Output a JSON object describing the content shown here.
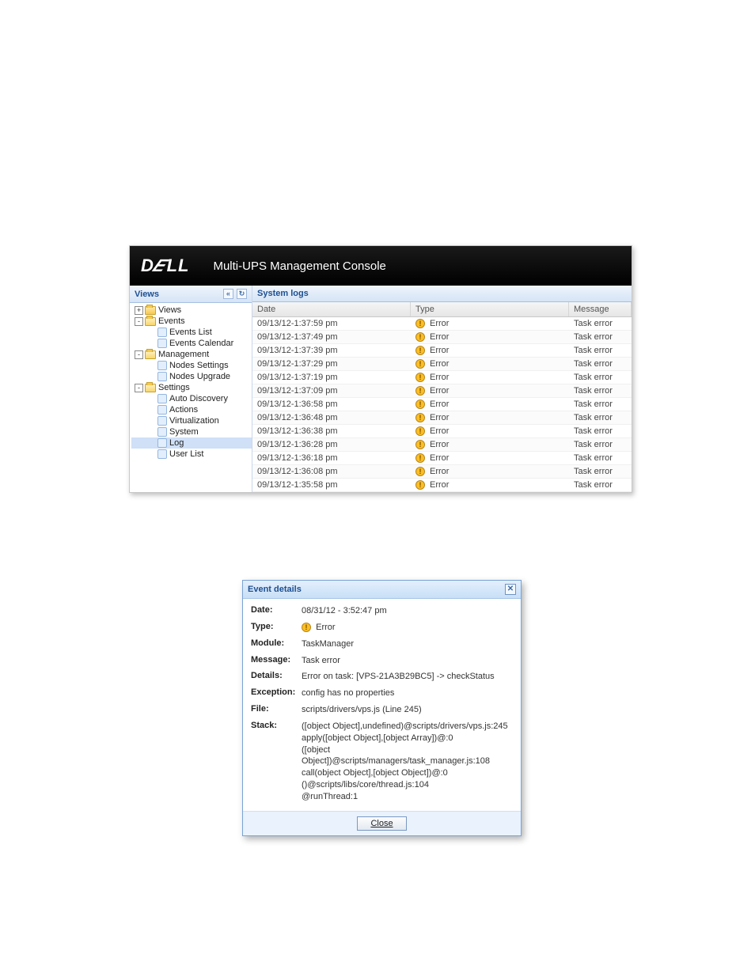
{
  "header": {
    "logo": "DELL",
    "title": "Multi-UPS Management Console"
  },
  "sidebar": {
    "title": "Views",
    "nodes": [
      {
        "label": "Views",
        "level": 1,
        "icon": "folder-closed",
        "toggle": "+",
        "interact": true,
        "name": "tree-views"
      },
      {
        "label": "Events",
        "level": 1,
        "icon": "folder-open",
        "toggle": "-",
        "interact": true,
        "name": "tree-events"
      },
      {
        "label": "Events List",
        "level": 2,
        "icon": "generic",
        "toggle": "",
        "interact": true,
        "name": "tree-events-list"
      },
      {
        "label": "Events Calendar",
        "level": 2,
        "icon": "generic",
        "toggle": "",
        "interact": true,
        "name": "tree-events-calendar"
      },
      {
        "label": "Management",
        "level": 1,
        "icon": "folder-open",
        "toggle": "-",
        "interact": true,
        "name": "tree-management"
      },
      {
        "label": "Nodes Settings",
        "level": 2,
        "icon": "generic",
        "toggle": "",
        "interact": true,
        "name": "tree-nodes-settings"
      },
      {
        "label": "Nodes Upgrade",
        "level": 2,
        "icon": "generic",
        "toggle": "",
        "interact": true,
        "name": "tree-nodes-upgrade"
      },
      {
        "label": "Settings",
        "level": 1,
        "icon": "folder-open",
        "toggle": "-",
        "interact": true,
        "name": "tree-settings"
      },
      {
        "label": "Auto Discovery",
        "level": 2,
        "icon": "generic",
        "toggle": "",
        "interact": true,
        "name": "tree-auto-discovery"
      },
      {
        "label": "Actions",
        "level": 2,
        "icon": "generic",
        "toggle": "",
        "interact": true,
        "name": "tree-actions"
      },
      {
        "label": "Virtualization",
        "level": 2,
        "icon": "generic",
        "toggle": "",
        "interact": true,
        "name": "tree-virtualization"
      },
      {
        "label": "System",
        "level": 2,
        "icon": "generic",
        "toggle": "",
        "interact": true,
        "name": "tree-system"
      },
      {
        "label": "Log",
        "level": 2,
        "icon": "generic",
        "toggle": "",
        "interact": true,
        "name": "tree-log",
        "selected": true
      },
      {
        "label": "User List",
        "level": 2,
        "icon": "generic",
        "toggle": "",
        "interact": true,
        "name": "tree-user-list"
      }
    ]
  },
  "grid": {
    "title": "System logs",
    "headers": {
      "date": "Date",
      "type": "Type",
      "message": "Message"
    },
    "rows": [
      {
        "date": "09/13/12-1:37:59 pm",
        "type": "Error",
        "message": "Task error"
      },
      {
        "date": "09/13/12-1:37:49 pm",
        "type": "Error",
        "message": "Task error"
      },
      {
        "date": "09/13/12-1:37:39 pm",
        "type": "Error",
        "message": "Task error"
      },
      {
        "date": "09/13/12-1:37:29 pm",
        "type": "Error",
        "message": "Task error"
      },
      {
        "date": "09/13/12-1:37:19 pm",
        "type": "Error",
        "message": "Task error"
      },
      {
        "date": "09/13/12-1:37:09 pm",
        "type": "Error",
        "message": "Task error"
      },
      {
        "date": "09/13/12-1:36:58 pm",
        "type": "Error",
        "message": "Task error"
      },
      {
        "date": "09/13/12-1:36:48 pm",
        "type": "Error",
        "message": "Task error"
      },
      {
        "date": "09/13/12-1:36:38 pm",
        "type": "Error",
        "message": "Task error"
      },
      {
        "date": "09/13/12-1:36:28 pm",
        "type": "Error",
        "message": "Task error"
      },
      {
        "date": "09/13/12-1:36:18 pm",
        "type": "Error",
        "message": "Task error"
      },
      {
        "date": "09/13/12-1:36:08 pm",
        "type": "Error",
        "message": "Task error"
      },
      {
        "date": "09/13/12-1:35:58 pm",
        "type": "Error",
        "message": "Task error"
      }
    ]
  },
  "dialog": {
    "title": "Event details",
    "labels": {
      "date": "Date:",
      "type": "Type:",
      "module": "Module:",
      "message": "Message:",
      "details": "Details:",
      "exception": "Exception:",
      "file": "File:",
      "stack": "Stack:"
    },
    "values": {
      "date": "08/31/12 - 3:52:47 pm",
      "type": "Error",
      "module": "TaskManager",
      "message": "Task error",
      "details": "Error on task: [VPS-21A3B29BC5] -> checkStatus",
      "exception": "config has no properties",
      "file": "scripts/drivers/vps.js (Line 245)",
      "stack": [
        "([object Object],undefined)@scripts/drivers/vps.js:245",
        "apply([object Object],[object Array])@:0",
        "([object Object])@scripts/managers/task_manager.js:108",
        "call(object Object],[object Object])@:0",
        "()@scripts/libs/core/thread.js:104",
        "@runThread:1"
      ]
    },
    "close_label": "Close"
  }
}
